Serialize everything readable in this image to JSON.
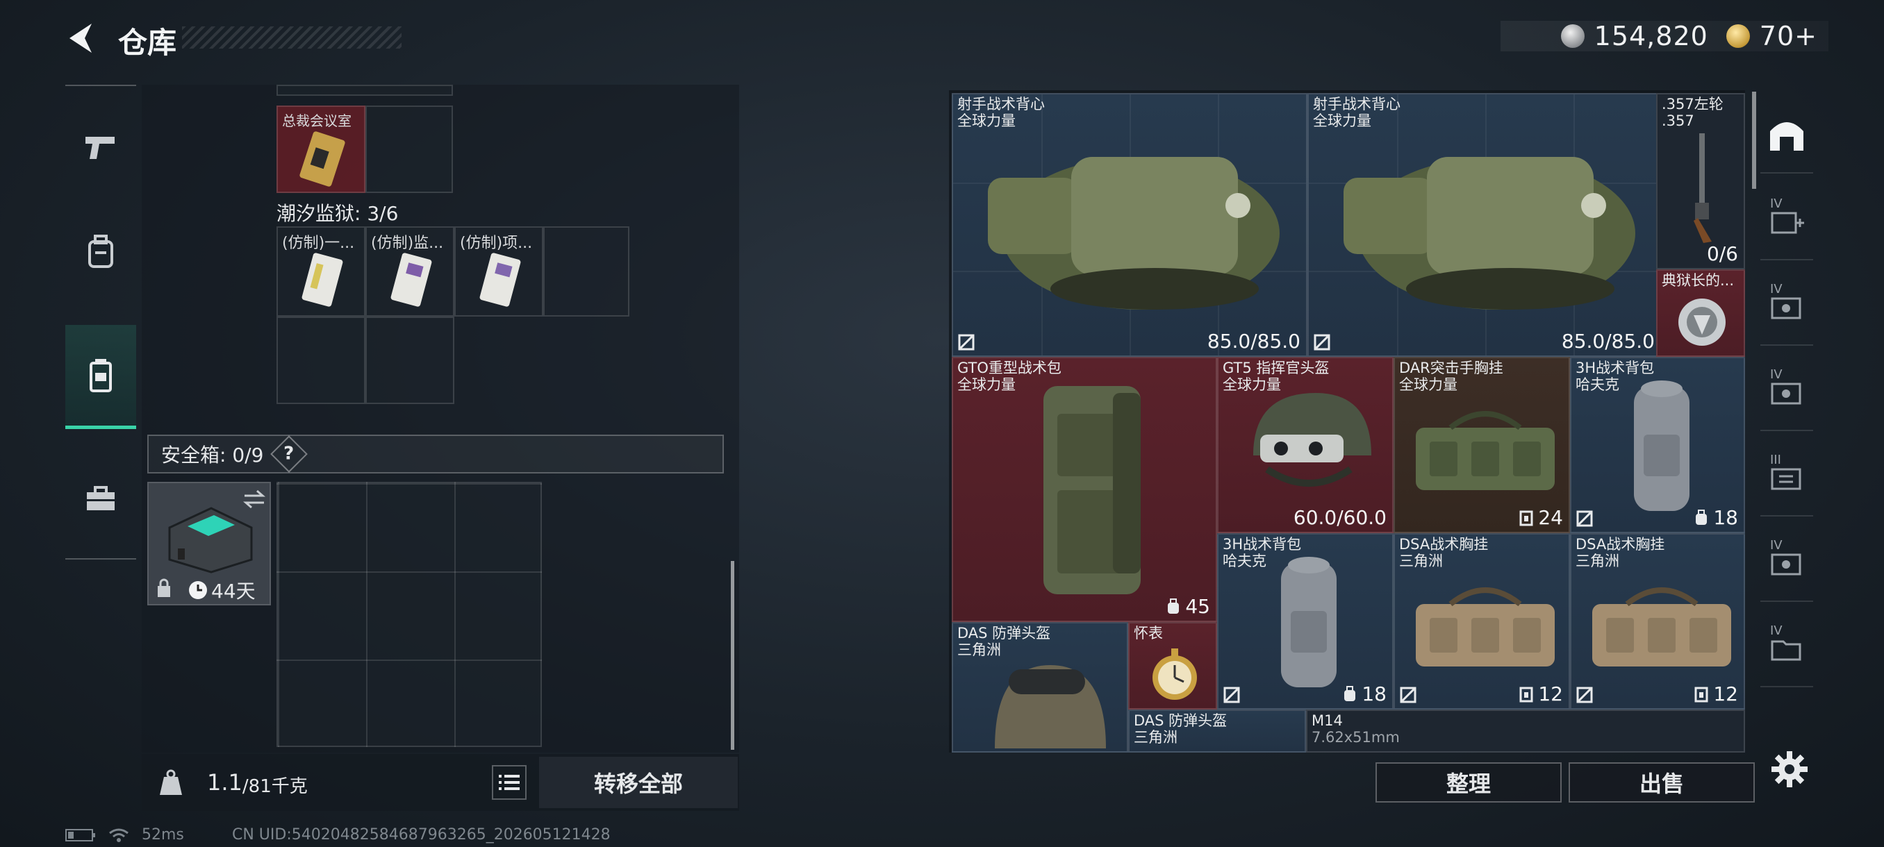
{
  "header": {
    "title": "仓库",
    "currency": [
      {
        "icon": "silver-coin-icon",
        "value": "154,820"
      },
      {
        "icon": "gold-coin-icon",
        "value": "70+"
      }
    ]
  },
  "left_nav": [
    "pistol-icon",
    "backpack-icon",
    "vest-icon",
    "toolbox-icon"
  ],
  "left_panel": {
    "room_label": "总裁会议室",
    "prison_label": "潮汐监狱: 3/6",
    "prison_items": [
      "(仿制)一...",
      "(仿制)监...",
      "(仿制)项..."
    ],
    "safe_label": "安全箱: 0/9",
    "help": "?",
    "safe_box": {
      "days": "44天"
    },
    "weight_value": "1.1",
    "weight_max": "/81千克",
    "transfer_all": "转移全部"
  },
  "right_panel": {
    "items": [
      {
        "name1": "射手战术背心",
        "name2": "全球力量",
        "value": "85.0/85.0"
      },
      {
        "name1": "射手战术背心",
        "name2": "全球力量",
        "value": "85.0/85.0"
      },
      {
        "name1": ".357左轮",
        "name2": ".357",
        "value": "0/6"
      },
      {
        "name1": "典狱长的...",
        "name2": "",
        "value": ""
      },
      {
        "name1": "GTO重型战术包",
        "name2": "全球力量",
        "value": "45"
      },
      {
        "name1": "GT5 指挥官头盔",
        "name2": "全球力量",
        "value": "60.0/60.0"
      },
      {
        "name1": "DAR突击手胸挂",
        "name2": "全球力量",
        "value": "24"
      },
      {
        "name1": "3H战术背包",
        "name2": "哈夫克",
        "value": "18"
      },
      {
        "name1": "3H战术背包",
        "name2": "哈夫克",
        "value": "18"
      },
      {
        "name1": "DSA战术胸挂",
        "name2": "三角洲",
        "value": "12"
      },
      {
        "name1": "DSA战术胸挂",
        "name2": "三角洲",
        "value": "12"
      },
      {
        "name1": "DAS 防弹头盔",
        "name2": "三角洲",
        "value": ""
      },
      {
        "name1": "怀表",
        "name2": "",
        "value": ""
      },
      {
        "name1": "DAS 防弹头盔",
        "name2": "三角洲",
        "value": ""
      },
      {
        "name1": "M14",
        "name2": "7.62x51mm",
        "value": ""
      }
    ],
    "tidy": "整理",
    "sell": "出售"
  },
  "right_tabs": [
    "locker-icon",
    "IV",
    "IV",
    "IV",
    "III",
    "IV",
    "IV"
  ],
  "status_bar": {
    "ping": "52ms",
    "uid": "CN UID:54020482584687963265_202605121428"
  }
}
